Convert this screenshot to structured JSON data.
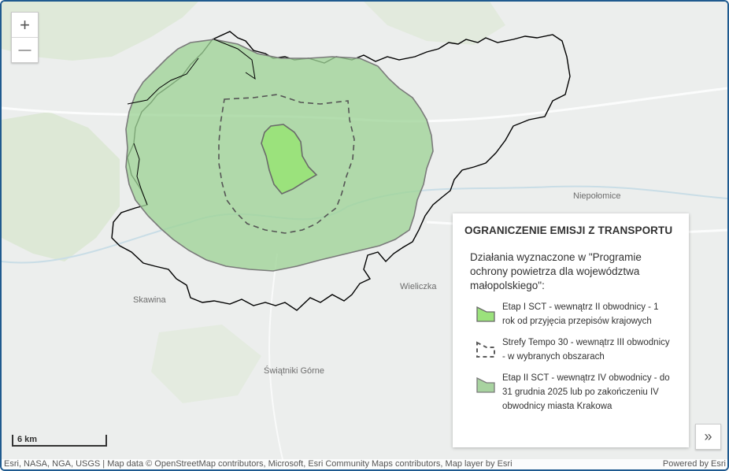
{
  "zoom": {
    "in_label": "+",
    "out_label": "—"
  },
  "places": {
    "niepolomice": "Niepołomice",
    "wieliczka": "Wieliczka",
    "skawina": "Skawina",
    "swiatniki": "Świątniki Górne"
  },
  "legend": {
    "title": "OGRANICZENIE EMISJI Z TRANSPORTU",
    "description": "Działania wyznaczone w \"Programie ochrony powietrza dla województwa małopolskiego\":",
    "items": [
      {
        "label": "Etap I SCT - wewnątrz II obwodnicy - 1 rok od przyjęcia przepisów krajowych",
        "fill": "#9be27c",
        "stroke": "#6a6a6a"
      },
      {
        "label": "Strefy Tempo 30 - wewnątrz III obwodnicy - w wybranych obszarach",
        "fill": "none",
        "stroke": "#5a5a5a"
      },
      {
        "label": "Etap II SCT - wewnątrz IV obwodnicy - do 31 grudnia 2025 lub po zakończeniu IV obwodnicy miasta Krakowa",
        "fill": "#a8d3a0",
        "stroke": "#7a7a7a"
      }
    ]
  },
  "expand_label": "»",
  "scale": {
    "label": "6 km"
  },
  "attribution": {
    "left": "Esri, NASA, NGA, USGS | Map data © OpenStreetMap contributors, Microsoft, Esri Community Maps contributors, Map layer by Esri",
    "right": "Powered by Esri"
  },
  "colors": {
    "stage2_fill": "#9fd497",
    "stage1_fill": "#9be27c",
    "boundary": "#000000",
    "frame": "#1f5a8f"
  }
}
